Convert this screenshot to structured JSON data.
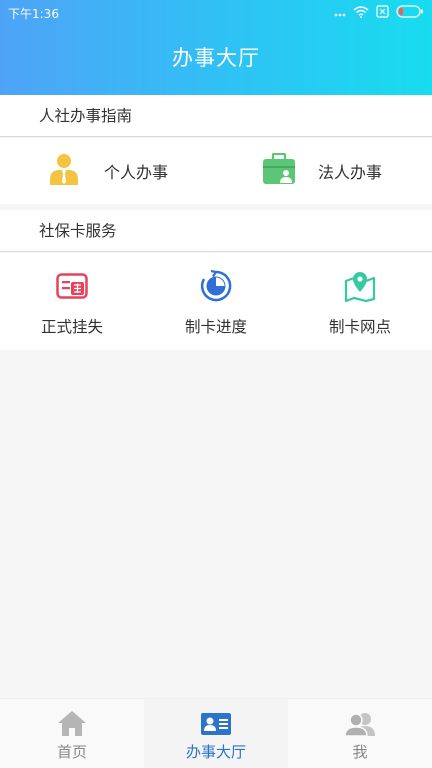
{
  "status_bar": {
    "time": "下午1:36"
  },
  "header": {
    "title": "办事大厅"
  },
  "guide_section": {
    "title": "人社办事指南",
    "items": [
      {
        "label": "个人办事",
        "icon": "person-icon"
      },
      {
        "label": "法人办事",
        "icon": "briefcase-person-icon"
      }
    ]
  },
  "card_section": {
    "title": "社保卡服务",
    "items": [
      {
        "label": "正式挂失",
        "icon": "report-loss-icon"
      },
      {
        "label": "制卡进度",
        "icon": "progress-icon"
      },
      {
        "label": "制卡网点",
        "icon": "map-pin-icon"
      }
    ]
  },
  "tabbar": {
    "items": [
      {
        "label": "首页",
        "icon": "home-icon",
        "active": false
      },
      {
        "label": "办事大厅",
        "icon": "id-card-icon",
        "active": true
      },
      {
        "label": "我",
        "icon": "user-group-icon",
        "active": false
      }
    ]
  },
  "colors": {
    "header_gradient": [
      "#4fa3f7",
      "#18dcef"
    ],
    "active_tab": "#2b74c9",
    "person_icon": "#f5c342",
    "briefcase_icon": "#5cc676",
    "report_loss_icon": "#e8415b",
    "progress_icon": "#2f6fd6",
    "map_icon": "#35c9a4"
  }
}
